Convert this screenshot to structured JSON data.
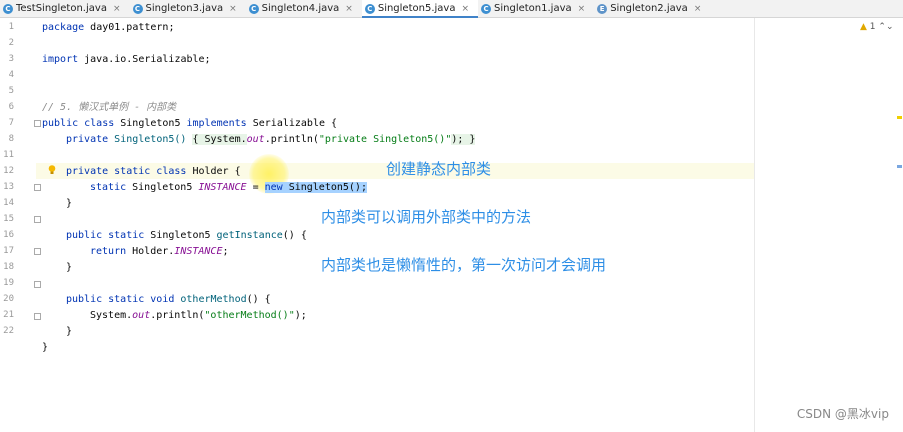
{
  "tabs": [
    {
      "label": "TestSingleton.java",
      "icon": "C"
    },
    {
      "label": "Singleton3.java",
      "icon": "C"
    },
    {
      "label": "Singleton4.java",
      "icon": "C"
    },
    {
      "label": "Singleton5.java",
      "icon": "C"
    },
    {
      "label": "Singleton1.java",
      "icon": "C"
    },
    {
      "label": "Singleton2.java",
      "icon": "E"
    }
  ],
  "tab_close": "×",
  "active_tab": "Singleton5.java",
  "inspection": {
    "count": "1"
  },
  "line_numbers": [
    "1",
    "2",
    "3",
    "4",
    "5",
    "6",
    "7",
    "8",
    "11",
    "12",
    "13",
    "14",
    "15",
    "16",
    "17",
    "18",
    "19",
    "20",
    "21",
    "22"
  ],
  "code": {
    "l1_kw": "package",
    "l1_rest": " day01.pattern;",
    "l3_kw": "import",
    "l3_rest": " java.io.Serializable;",
    "l6": "// 5. 懒汉式单例 - 内部类",
    "l7_a": "public class",
    "l7_b": " Singleton5 ",
    "l7_c": "implements",
    "l7_d": " Serializable {",
    "l8_a": "private",
    "l8_b": " Singleton5() ",
    "l8_c": "{ System.",
    "l8_d": "out",
    "l8_e": ".println(",
    "l8_f": "\"private Singleton5()\"",
    "l8_g": "); }",
    "l11_a": "private static class",
    "l11_b": " Holder {",
    "l12_a": "static",
    "l12_b": " Singleton5 ",
    "l12_c": "INSTANCE",
    "l12_d": " = ",
    "l12_e": "new",
    "l12_f": " Singleton5();",
    "l13": "}",
    "l15_a": "public static",
    "l15_b": " Singleton5 ",
    "l15_c": "getInstance",
    "l15_d": "() {",
    "l16_a": "return",
    "l16_b": " Holder.",
    "l16_c": "INSTANCE",
    "l16_d": ";",
    "l17": "}",
    "l19_a": "public static void",
    "l19_b": " otherMethod",
    "l19_c": "() {",
    "l20_a": "System.",
    "l20_b": "out",
    "l20_c": ".println(",
    "l20_d": "\"otherMethod()\"",
    "l20_e": ");",
    "l21": "}",
    "l22": "}"
  },
  "annotations": {
    "a1": "创建静态内部类",
    "a2": "内部类可以调用外部类中的方法",
    "a3": "内部类也是懒惰性的，第一次访问才会调用"
  },
  "watermark": "CSDN @黑冰vip",
  "colors": {
    "keyword": "#0033b3",
    "string": "#067d17",
    "field": "#871094",
    "annotation": "#2d8ee6",
    "selection": "#a6d2ff"
  }
}
